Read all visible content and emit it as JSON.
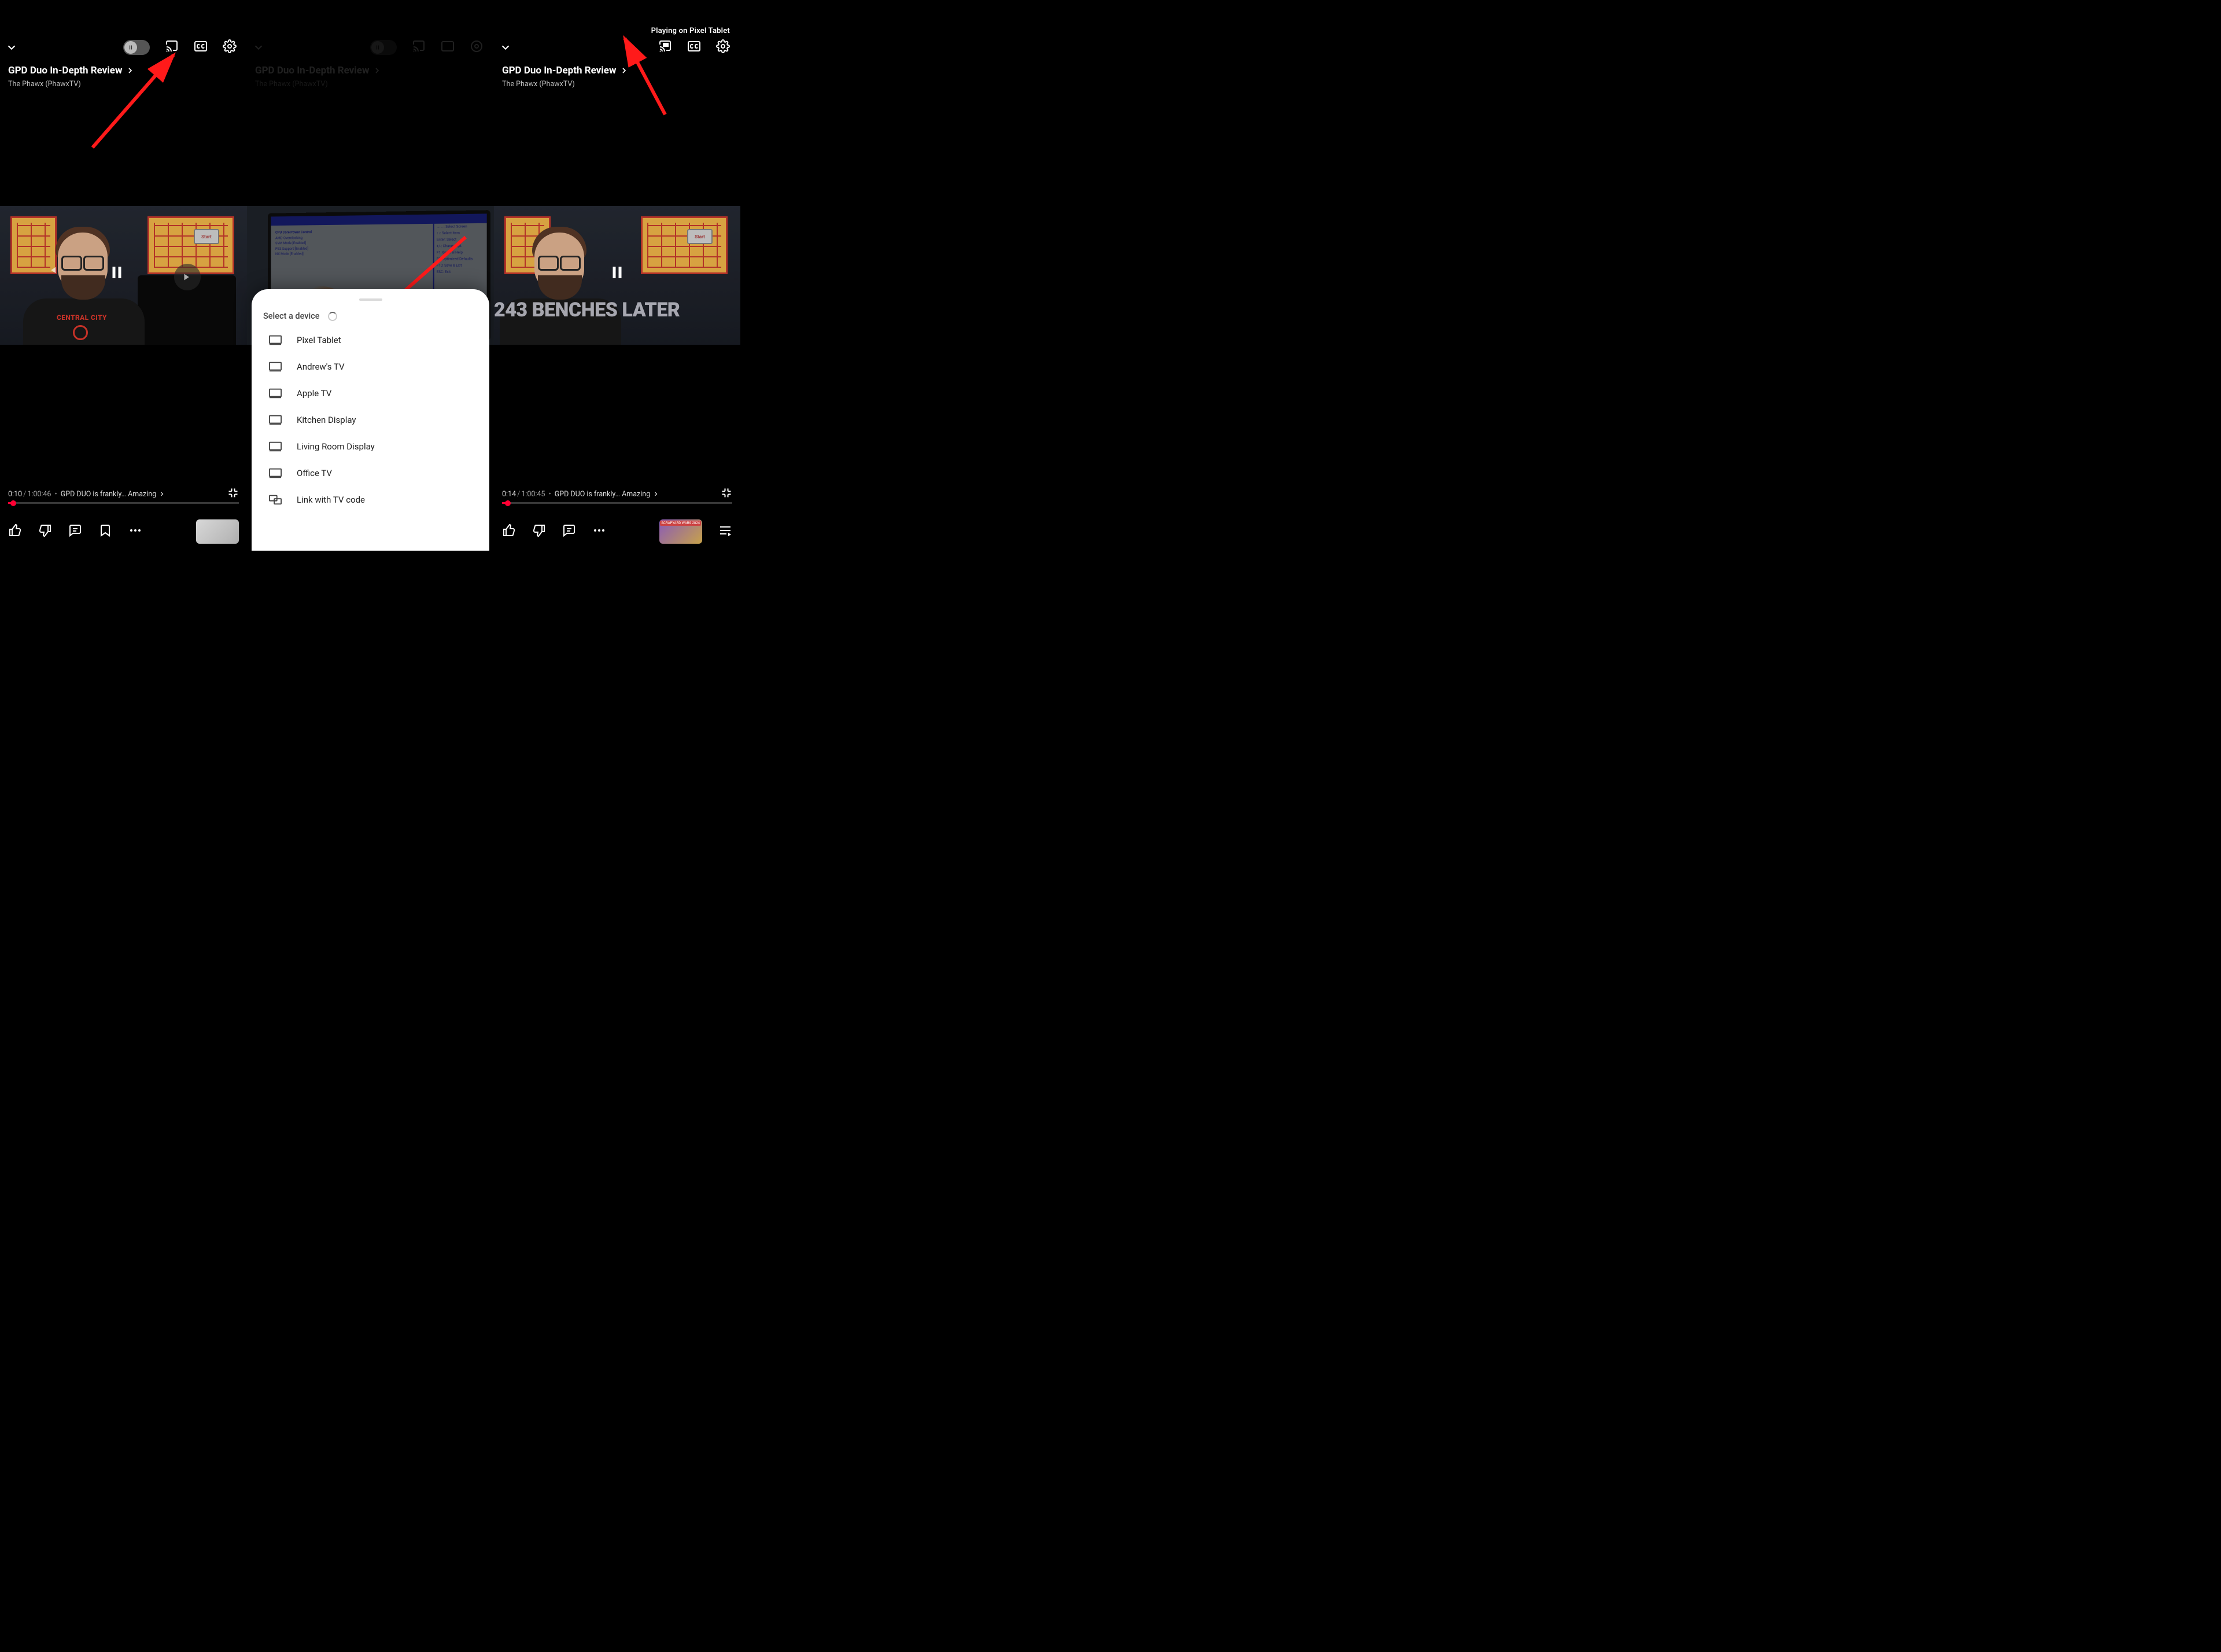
{
  "video": {
    "title": "GPD Duo In-Depth Review",
    "channel": "The Phawx (PhawxTV)",
    "chapter": "GPD DUO is frankly… Amazing",
    "duration": "1:00:46",
    "overlay_text_right": "243 BENCHES LATER",
    "shirt_logo": "CENTRAL CITY"
  },
  "left": {
    "current_time": "0:10",
    "duration": "1:00:46"
  },
  "right": {
    "current_time": "0:14",
    "duration": "1:00:45",
    "status": "Playing on Pixel Tablet"
  },
  "bios": {
    "title": "Aptio Setup - AMI",
    "section": "CPU Core Power Control",
    "lines": [
      "CPU Core Power Control",
      "AMD Overclocking",
      "SVM Mode                  [Enabled]",
      "PSS Support               [Enabled]",
      "NX Mode                   [Enabled]"
    ],
    "side": [
      "→←: Select Screen",
      "↑↓: Select Item",
      "Enter: Select",
      "+/-: Change Opt.",
      "F1: General Help",
      "F9: Optimized Defaults",
      "F10: Save & Exit",
      "ESC: Exit"
    ]
  },
  "start_button": "Start",
  "sheet": {
    "header": "Select a device",
    "devices": [
      "Pixel Tablet",
      "Andrew's TV",
      "Apple TV",
      "Kitchen Display",
      "Living Room Display",
      "Office TV"
    ],
    "link_code": "Link with TV code"
  },
  "nextthumb_tag": "SCRAPYARD WARS 2024"
}
